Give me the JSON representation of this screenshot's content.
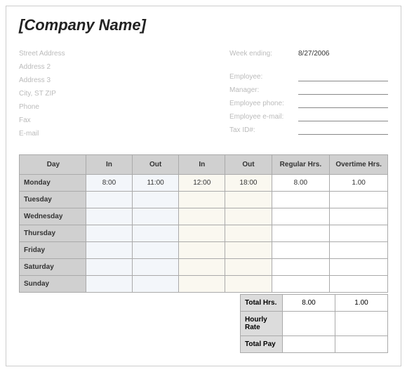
{
  "title": "[Company Name]",
  "address": {
    "street": "Street Address",
    "addr2": "Address 2",
    "addr3": "Address 3",
    "csz": "City, ST  ZIP",
    "phone": "Phone",
    "fax": "Fax",
    "email": "E-mail"
  },
  "meta": {
    "week_ending_label": "Week ending:",
    "week_ending_value": "8/27/2006",
    "employee_label": "Employee:",
    "manager_label": "Manager:",
    "emp_phone_label": "Employee phone:",
    "emp_email_label": "Employee e-mail:",
    "tax_id_label": "Tax ID#:"
  },
  "headers": {
    "day": "Day",
    "in1": "In",
    "out1": "Out",
    "in2": "In",
    "out2": "Out",
    "reg": "Regular Hrs.",
    "ot": "Overtime Hrs."
  },
  "rows": [
    {
      "day": "Monday",
      "in1": "8:00",
      "out1": "11:00",
      "in2": "12:00",
      "out2": "18:00",
      "reg": "8.00",
      "ot": "1.00"
    },
    {
      "day": "Tuesday",
      "in1": "",
      "out1": "",
      "in2": "",
      "out2": "",
      "reg": "",
      "ot": ""
    },
    {
      "day": "Wednesday",
      "in1": "",
      "out1": "",
      "in2": "",
      "out2": "",
      "reg": "",
      "ot": ""
    },
    {
      "day": "Thursday",
      "in1": "",
      "out1": "",
      "in2": "",
      "out2": "",
      "reg": "",
      "ot": ""
    },
    {
      "day": "Friday",
      "in1": "",
      "out1": "",
      "in2": "",
      "out2": "",
      "reg": "",
      "ot": ""
    },
    {
      "day": "Saturday",
      "in1": "",
      "out1": "",
      "in2": "",
      "out2": "",
      "reg": "",
      "ot": ""
    },
    {
      "day": "Sunday",
      "in1": "",
      "out1": "",
      "in2": "",
      "out2": "",
      "reg": "",
      "ot": ""
    }
  ],
  "summary": {
    "total_hrs_label": "Total Hrs.",
    "total_reg": "8.00",
    "total_ot": "1.00",
    "hourly_rate_label": "Hourly Rate",
    "hourly_rate_reg": "",
    "hourly_rate_ot": "",
    "total_pay_label": "Total Pay",
    "total_pay_reg": "",
    "total_pay_ot": ""
  }
}
